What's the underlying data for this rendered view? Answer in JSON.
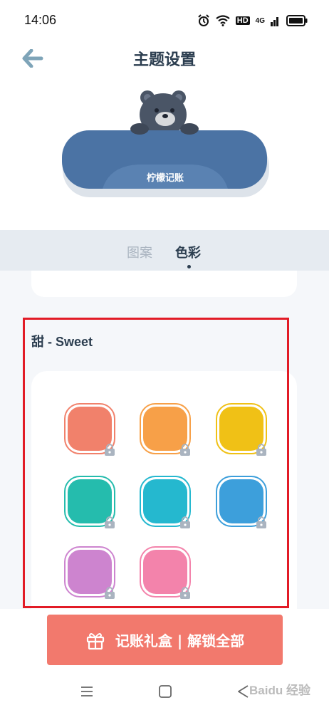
{
  "status_bar": {
    "time": "14:06",
    "icons": [
      "alarm-icon",
      "wifi-icon",
      "hd-icon",
      "signal-4g-icon",
      "battery-icon"
    ],
    "hd_label": "HD",
    "network_label": "4G"
  },
  "header": {
    "title": "主题设置",
    "back_icon": "arrow-left-icon"
  },
  "preview": {
    "label": "柠檬记账"
  },
  "tabs": [
    {
      "label": "图案",
      "active": false
    },
    {
      "label": "色彩",
      "active": true
    }
  ],
  "section": {
    "title": "甜 - Sweet"
  },
  "swatches": [
    {
      "color": "#f1816b",
      "border": "#f1816b",
      "locked": true
    },
    {
      "color": "#f7a048",
      "border": "#f7a048",
      "locked": true
    },
    {
      "color": "#f0c116",
      "border": "#f0c116",
      "locked": true
    },
    {
      "color": "#25bcad",
      "border": "#25bcad",
      "locked": true
    },
    {
      "color": "#25b8cf",
      "border": "#25b8cf",
      "locked": true
    },
    {
      "color": "#3d9fdb",
      "border": "#3d9fdb",
      "locked": true
    },
    {
      "color": "#cd84cf",
      "border": "#cd84cf",
      "locked": true
    },
    {
      "color": "#f383ab",
      "border": "#f383ab",
      "locked": true
    }
  ],
  "unlock_button": {
    "label": "记账礼盒 | 解锁全部",
    "icon": "gift-icon"
  },
  "nav": {
    "icons": [
      "menu-icon",
      "home-icon",
      "back-triangle-icon"
    ]
  },
  "watermark": "Baidu 经验",
  "colors": {
    "accent": "#f2796d",
    "header_text": "#2c3e50",
    "highlight": "#e21b26"
  }
}
